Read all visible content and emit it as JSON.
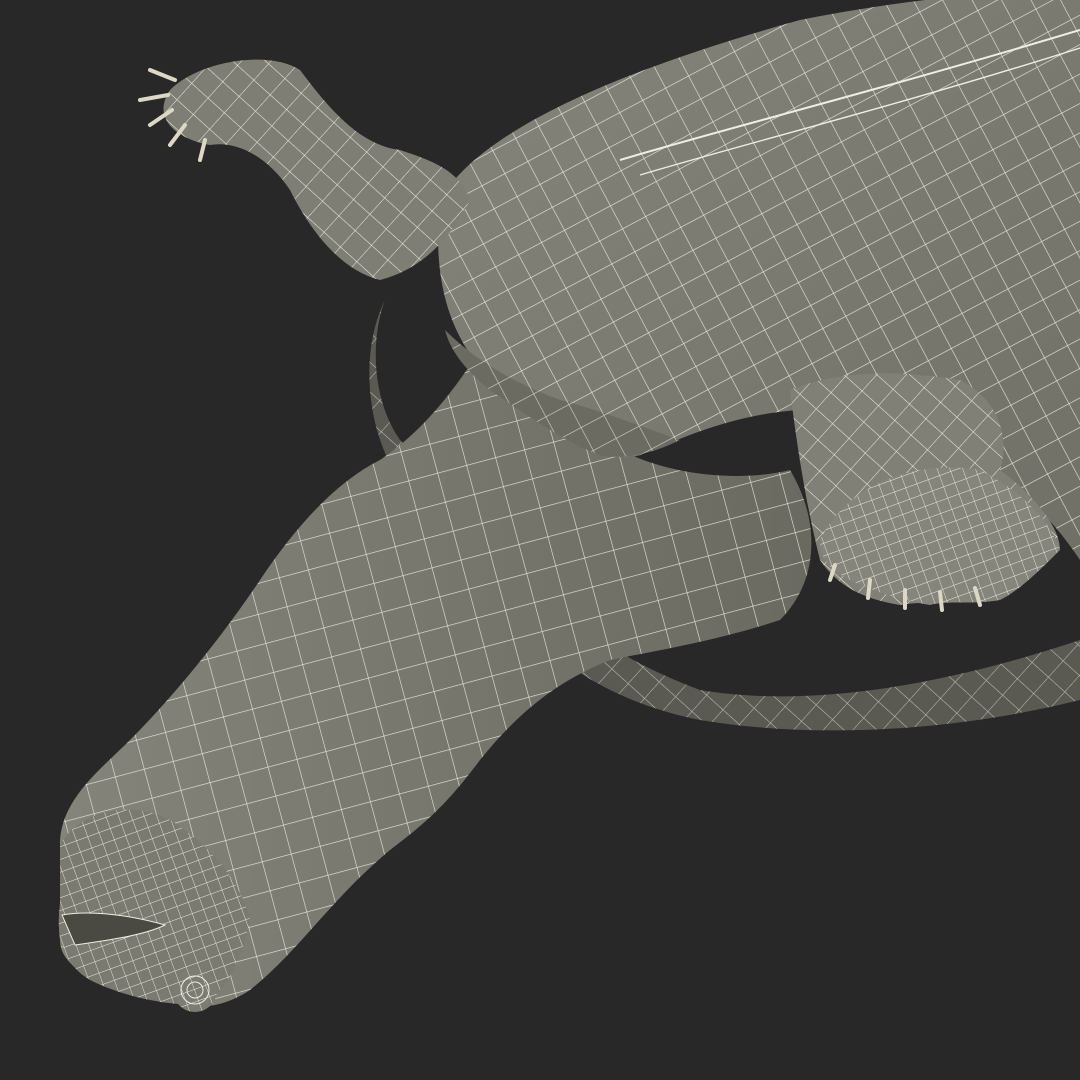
{
  "scene": {
    "subject": "wireframe-softshell-turtle",
    "render_style": "wireframe-over-shaded",
    "colors": {
      "background": "#282828",
      "surface": "#7b7b71",
      "surface_light": "#8f8f85",
      "surface_dark": "#5e5e55",
      "wire": "#f0ede1"
    }
  }
}
